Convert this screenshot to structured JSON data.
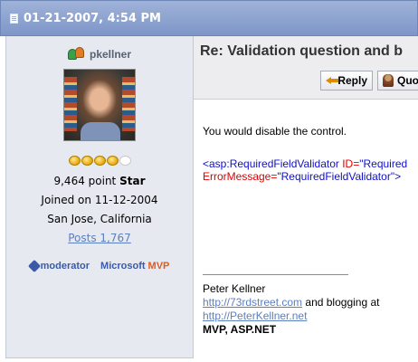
{
  "header": {
    "timestamp": "01-21-2007, 4:54 PM"
  },
  "user": {
    "name": "pkellner",
    "points": "9,464 point",
    "rank": "Star",
    "joined": "Joined on 11-12-2004",
    "location": "San Jose, California",
    "posts": "Posts 1,767",
    "stars_filled": 4,
    "stars_total": 5,
    "badge_moderator": "moderator",
    "badge_mvp_prefix": "Microsoft",
    "badge_mvp": "MVP"
  },
  "post": {
    "title": "Re: Validation question and b",
    "reply_label": "Reply",
    "quote_label": "Quo",
    "body_text": "You would disable the control.",
    "code_line1_tag": "<asp:RequiredFieldValidator",
    "code_line1_attr": "ID=",
    "code_line1_val": "\"Required",
    "code_line2_attr": "ErrorMessage=",
    "code_line2_val": "\"RequiredFieldValidator\">",
    "signature": {
      "name": "Peter Kellner",
      "link1": "http://73rdstreet.com",
      "link1_suffix": " and blogging at",
      "link2": "http://PeterKellner.net",
      "title": "MVP, ASP.NET"
    }
  },
  "colors": {
    "header_bg": "#7e96c8",
    "panel_bg": "#e6e9f0",
    "link": "#5c7fbf",
    "code_blue": "#1010c8",
    "code_red": "#e00000"
  }
}
